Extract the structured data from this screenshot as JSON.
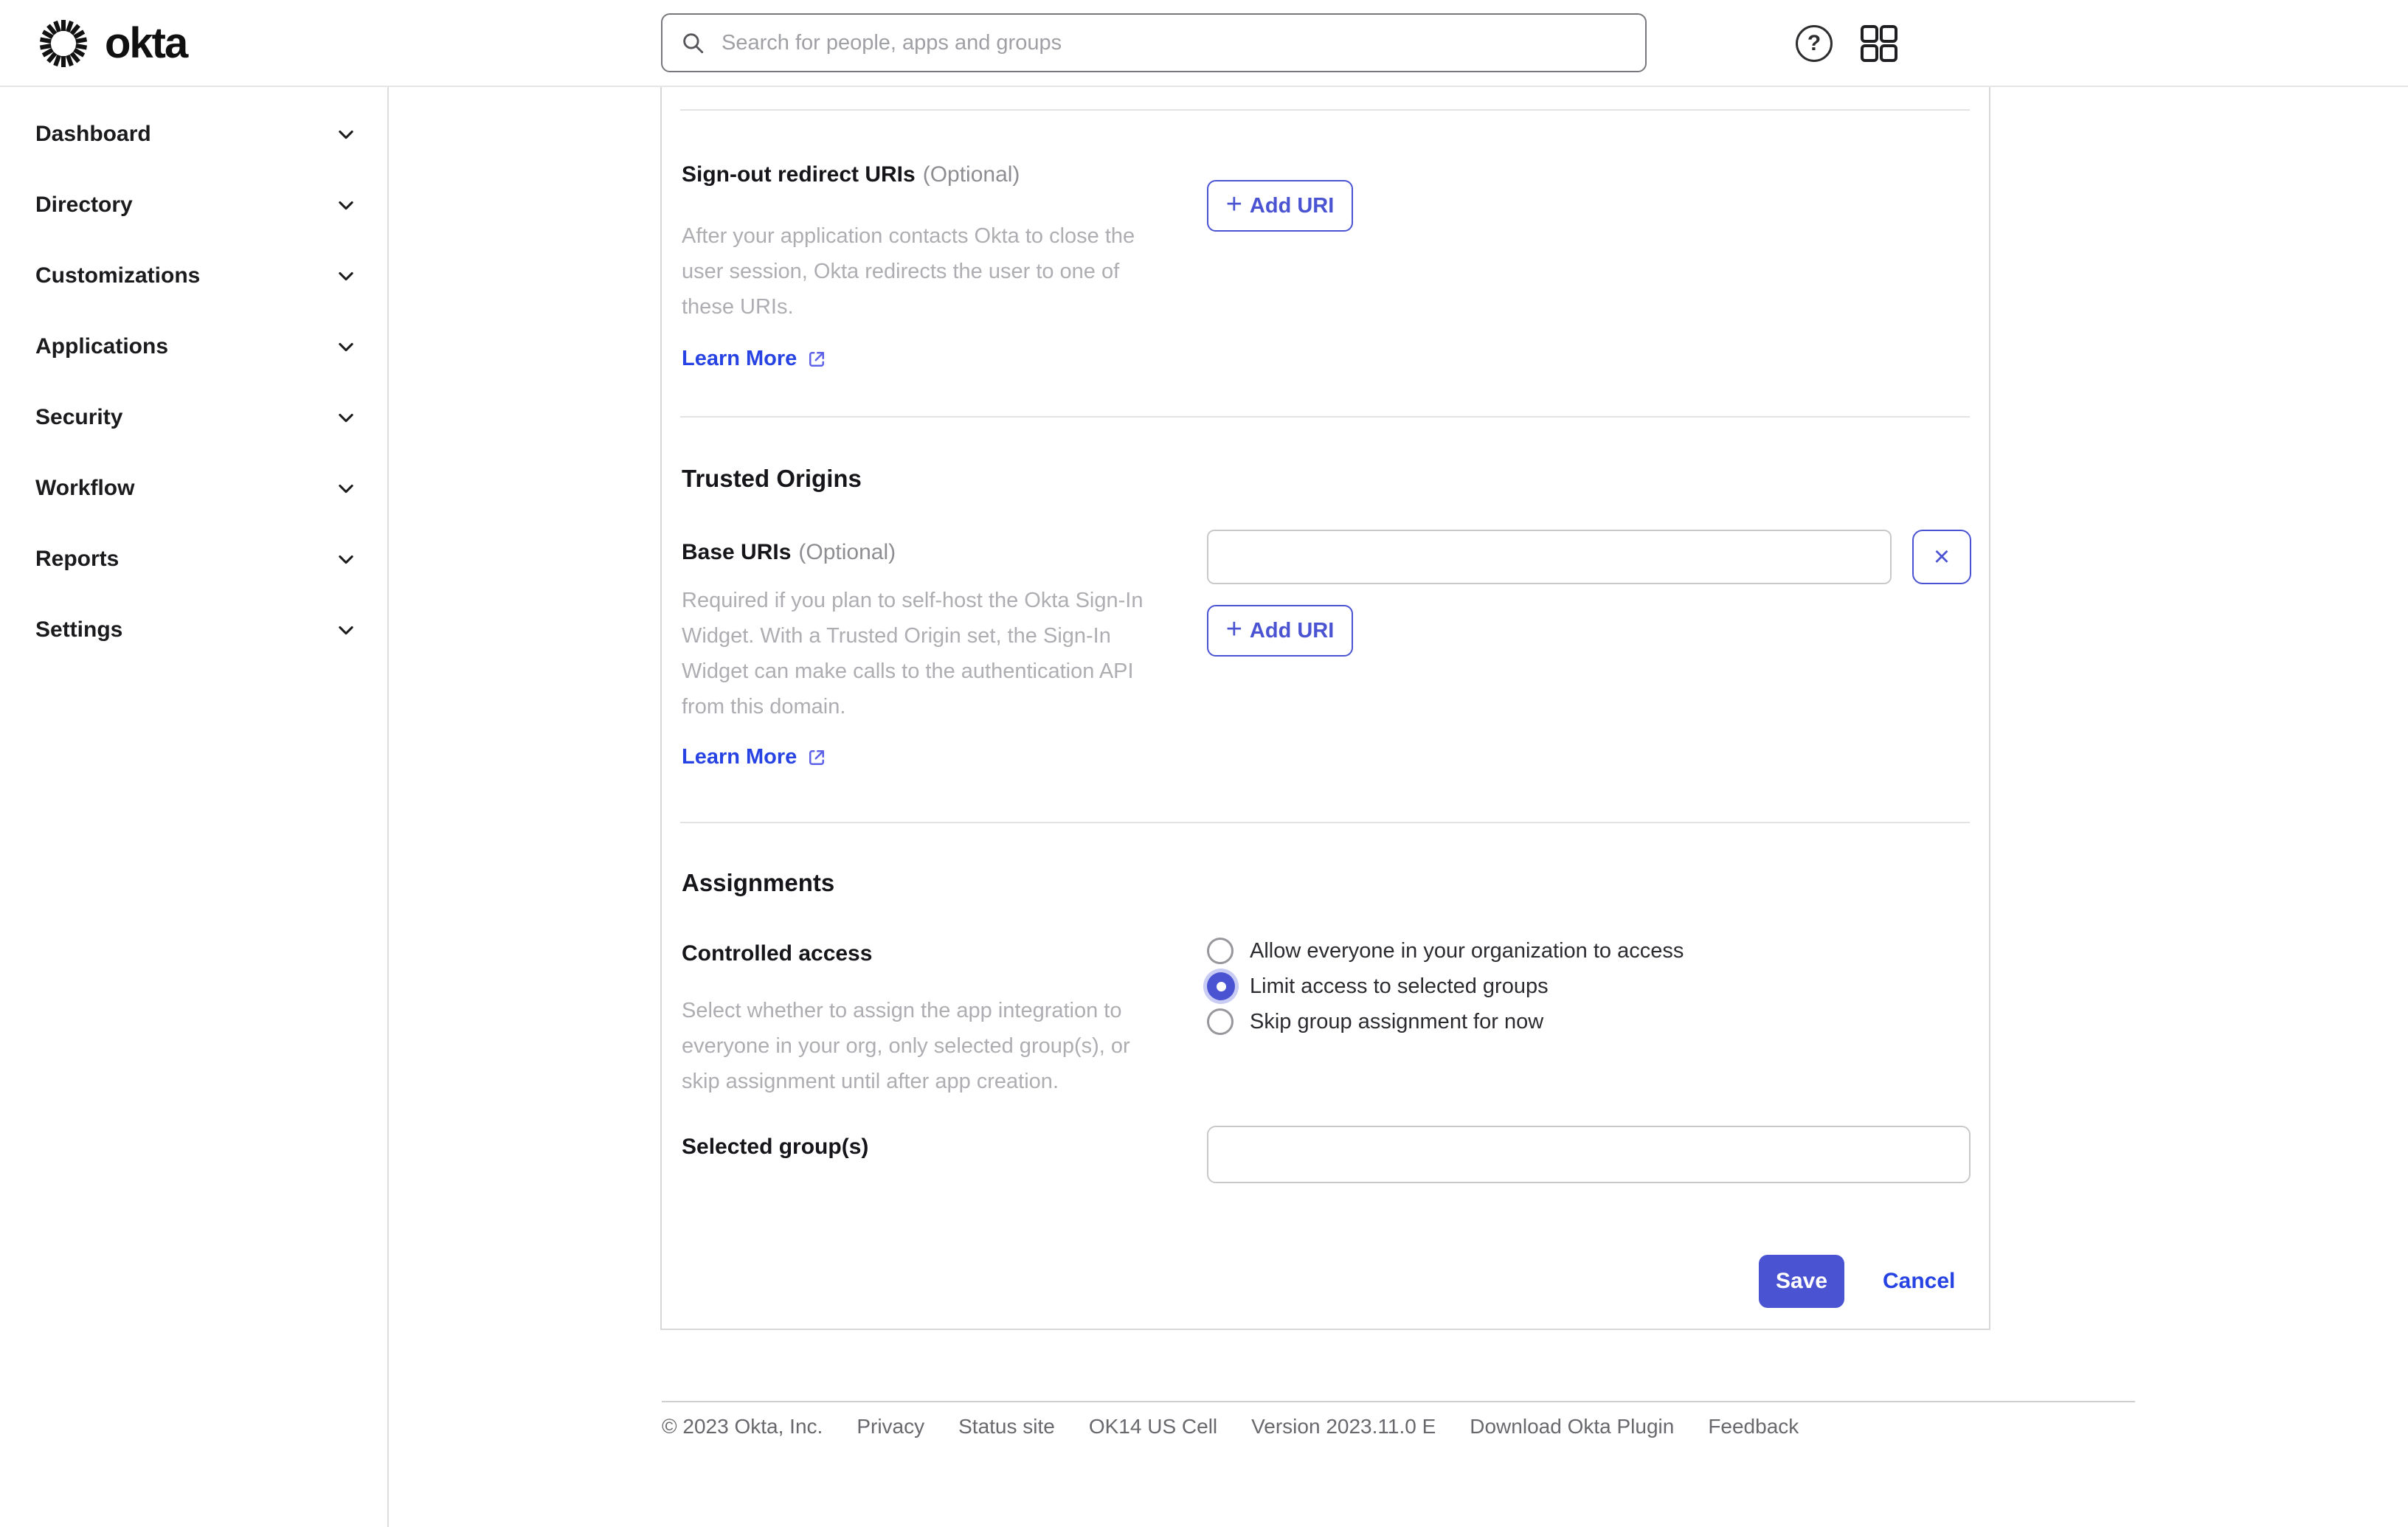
{
  "colors": {
    "primary": "#4a53d1",
    "link": "#2743e3",
    "halo": "#c9ccf3",
    "ext_icon": "#5e62e8"
  },
  "header": {
    "brand": "okta",
    "search_placeholder": "Search for people, apps and groups"
  },
  "sidebar": {
    "items": [
      {
        "label": "Dashboard"
      },
      {
        "label": "Directory"
      },
      {
        "label": "Customizations"
      },
      {
        "label": "Applications"
      },
      {
        "label": "Security"
      },
      {
        "label": "Workflow"
      },
      {
        "label": "Reports"
      },
      {
        "label": "Settings"
      }
    ]
  },
  "sections": {
    "signout": {
      "label": "Sign-out redirect URIs",
      "optional": "(Optional)",
      "description": "After your application contacts Okta to close the user session, Okta redirects the user to one of these URIs.",
      "learn_more": "Learn More",
      "add_uri": "Add URI"
    },
    "trusted": {
      "heading": "Trusted Origins",
      "base_label": "Base URIs",
      "optional": "(Optional)",
      "base_value": "",
      "description": "Required if you plan to self-host the Okta Sign-In Widget. With a Trusted Origin set, the Sign-In Widget can make calls to the authentication API from this domain.",
      "learn_more": "Learn More",
      "add_uri": "Add URI"
    },
    "assignments": {
      "heading": "Assignments",
      "controlled_label": "Controlled access",
      "description": "Select whether to assign the app integration to everyone in your org, only selected group(s), or skip assignment until after app creation.",
      "options": [
        {
          "label": "Allow everyone in your organization to access",
          "selected": false
        },
        {
          "label": "Limit access to selected groups",
          "selected": true
        },
        {
          "label": "Skip group assignment for now",
          "selected": false
        }
      ],
      "groups_label": "Selected group(s)",
      "groups_value": ""
    }
  },
  "actions": {
    "save": "Save",
    "cancel": "Cancel"
  },
  "icons": {
    "plus": "+",
    "close": "×",
    "question": "?"
  },
  "footer": {
    "items": [
      "© 2023 Okta, Inc.",
      "Privacy",
      "Status site",
      "OK14 US Cell",
      "Version 2023.11.0 E",
      "Download Okta Plugin",
      "Feedback"
    ]
  }
}
